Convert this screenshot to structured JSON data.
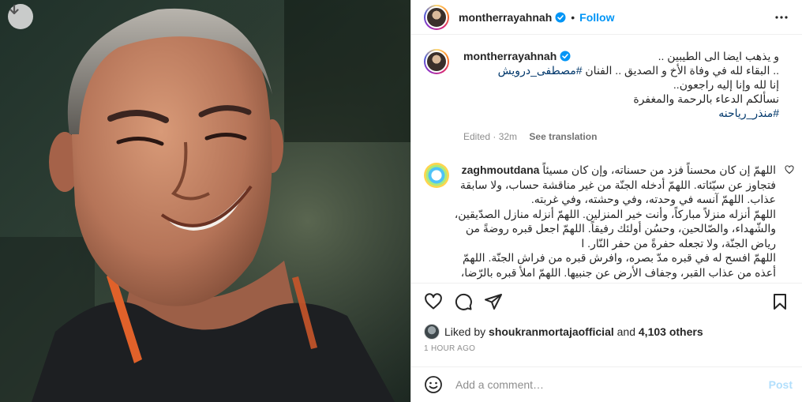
{
  "colors": {
    "accent": "#0095f6",
    "hashtag": "#00376b",
    "muted": "#8e8e8e",
    "border": "#dbdbdb"
  },
  "header": {
    "username": "montherrayahnah",
    "separator": "•",
    "follow_label": "Follow"
  },
  "caption": {
    "username": "montherrayahnah",
    "lines": [
      {
        "text": "و يذهب ايضا الى الطيبين ..",
        "hashtag": ""
      },
      {
        "text": ".. البقاء لله في وفاة الأخ و الصديق .. الفنان ",
        "hashtag": "#مصطفى_درويش"
      },
      {
        "text": "إنا لله وإنا إليه راجعون..",
        "hashtag": ""
      },
      {
        "text": "نسألكم الدعاء بالرحمة والمغفرة",
        "hashtag": ""
      },
      {
        "text": "",
        "hashtag": "#منذر_رياحنه"
      }
    ],
    "edited": "Edited · 32m",
    "see_translation": "See translation"
  },
  "comment": {
    "username": "zaghmoutdana",
    "lines": [
      "اللهمّ إن كان محسناً فزد من حسناته، وإن كان مسيئاً",
      "فتجاوز عن سيّئاته. اللهمّ أدخله الجنّة من غير مناقشة حساب، ولا سابقة",
      "عذاب. اللهمّ آنسه في وحدته، وفي وحشته، وفي غربته.",
      "اللهمّ أنزله منزلاً مباركاً، وأنت خير المنزلين. اللهمّ أنزله منازل الصدّيقين،",
      "والشّهداء، والصّالحين، وحسُن أولئك رفيقاً. اللهمّ اجعل قبره روضةً من",
      "رياض الجنّة، ولا تجعله حفرةً من حفر النّار. ا",
      "اللهمّ افسح له في قبره مدّ بصره، وافرش قبره من فراش الجنّة. اللهمّ",
      "أعذه من عذاب القبر، وجفاف الأرض عن جنبيها. اللهمّ املأ قبره بالرّضا،"
    ]
  },
  "likes": {
    "prefix": "Liked by",
    "user": "shoukranmortajaofficial",
    "middle": "and",
    "others": "4,103 others"
  },
  "timestamp": "1 HOUR AGO",
  "add_comment": {
    "placeholder": "Add a comment…",
    "post_label": "Post"
  },
  "icons": {
    "download": "download-arrow-icon",
    "verified": "verified-badge-icon",
    "more": "more-options-icon",
    "like": "heart-icon",
    "comment": "comment-bubble-icon",
    "share": "paper-plane-icon",
    "save": "bookmark-icon",
    "emoji": "emoji-smile-icon"
  }
}
